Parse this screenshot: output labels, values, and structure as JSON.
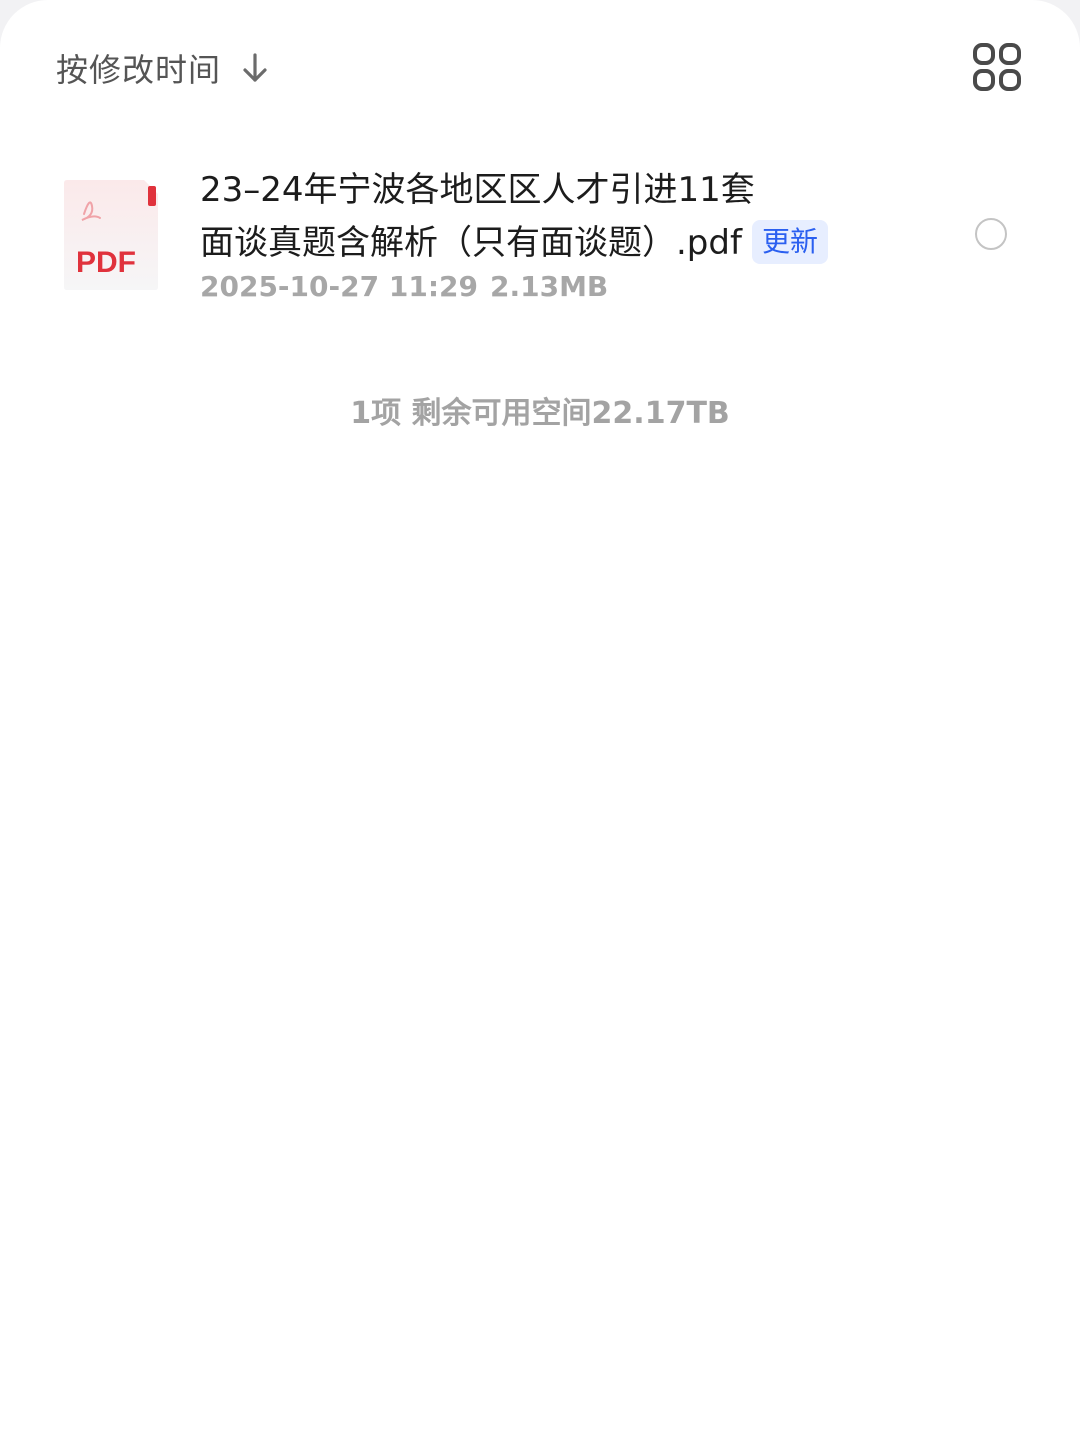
{
  "toolbar": {
    "sort_label": "按修改时间",
    "sort_icon": "arrow-down-icon",
    "view_icon": "grid-view-icon"
  },
  "files": [
    {
      "icon": "pdf-file-icon",
      "thumb_label": "PDF",
      "name_line1": "23–24年宁波各地区区人才引进11套",
      "name_line2": "面谈真题含解析（只有面谈题）.pdf",
      "tag": "更新",
      "modified": "2025-10-27 11:29",
      "size": "2.13MB"
    }
  ],
  "summary": {
    "count": "1项",
    "space": "剩余可用空间22.17TB"
  },
  "colors": {
    "accent_blue": "#2a5ff0",
    "tag_bg": "#e7eeff",
    "pdf_red": "#e0323c"
  }
}
